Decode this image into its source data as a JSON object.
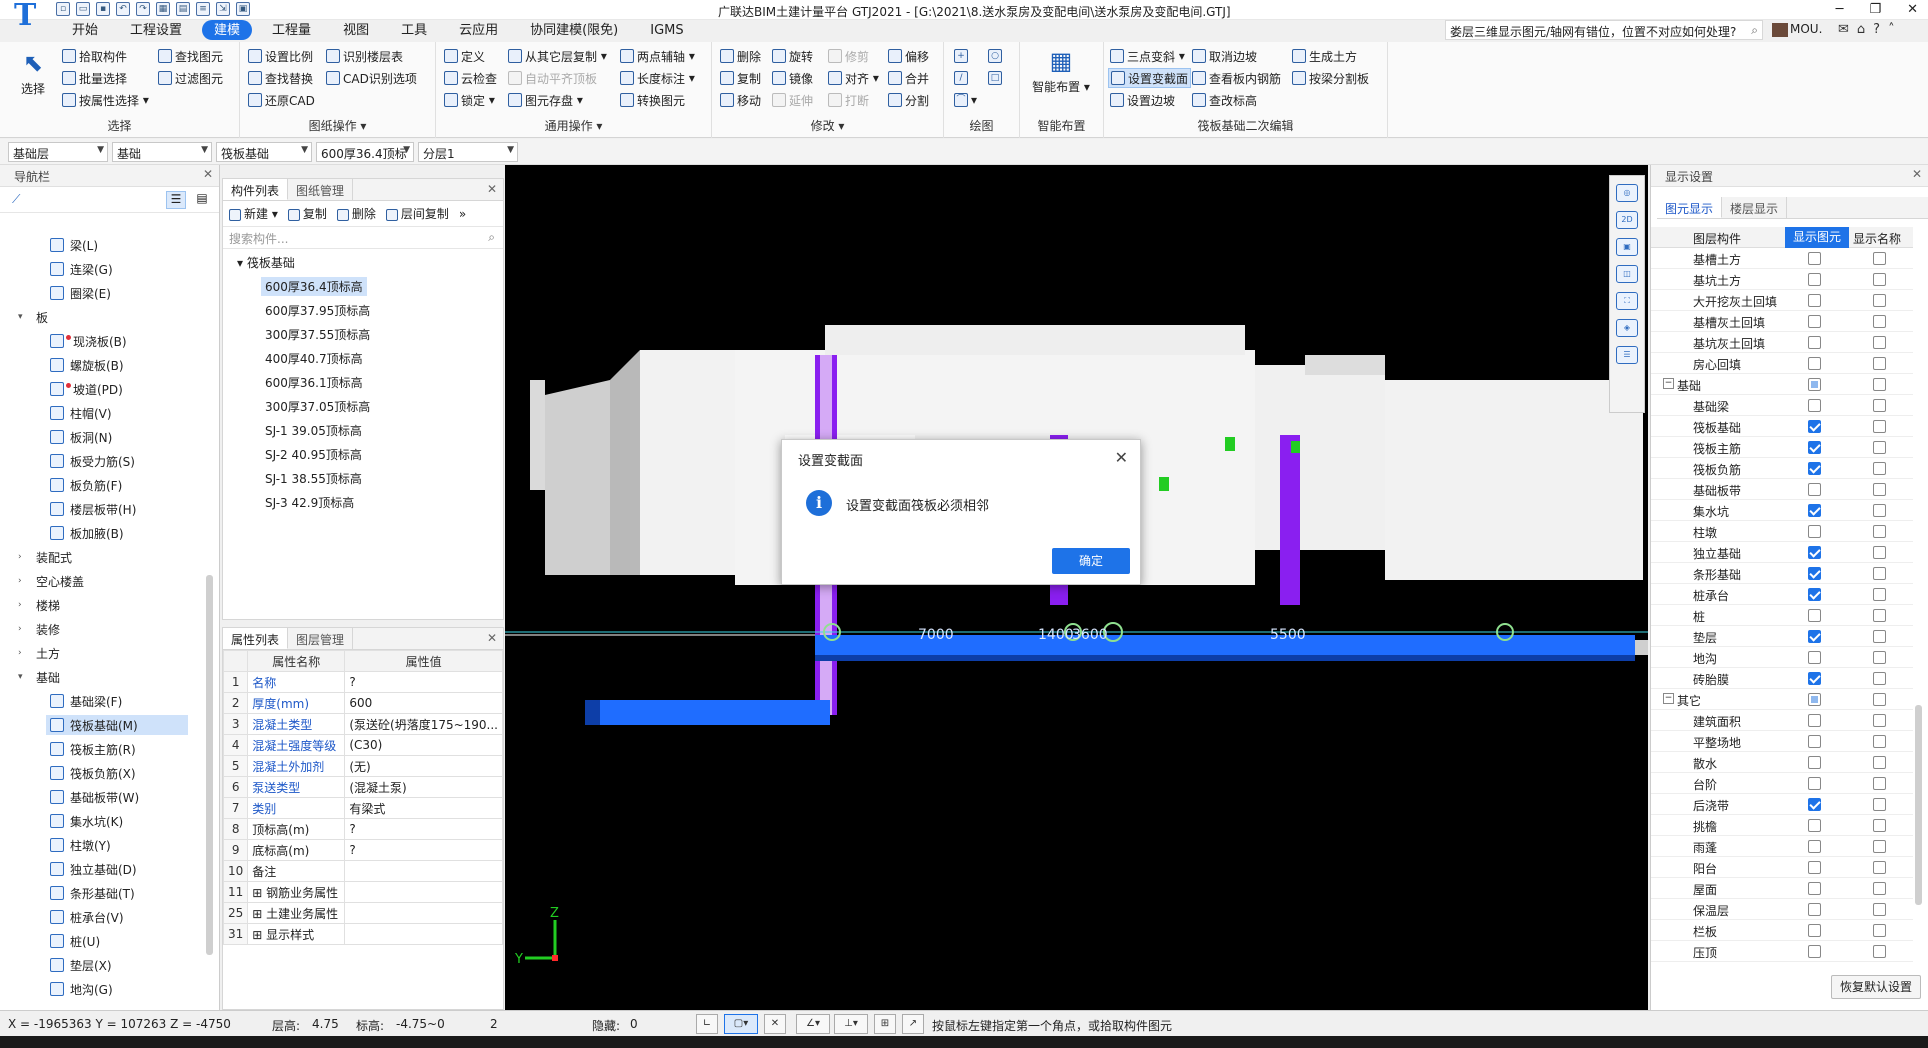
{
  "app": {
    "title": "广联达BIM土建计量平台 GTJ2021 - [G:\\2021\\8.送水泵房及变配电间\\送水泵房及变配电间.GTJ]",
    "logo": "T",
    "help_query": "娄层三维显示图元/轴网有错位，位置不对应如何处理?",
    "user": "MOU."
  },
  "menu": [
    "开始",
    "工程设置",
    "建模",
    "工程量",
    "视图",
    "工具",
    "云应用",
    "协同建模(限免)",
    "IGMS"
  ],
  "menu_active": 2,
  "ribbon": {
    "select": {
      "label": "选择",
      "big": "选择",
      "items": [
        "拾取构件",
        "批量选择",
        "按属性选择",
        "查找图元",
        "过滤图元"
      ]
    },
    "drawing_ops": {
      "label": "图纸操作",
      "items": [
        "设置比例",
        "查找替换",
        "还原CAD",
        "识别楼层表",
        "CAD识别选项"
      ]
    },
    "general_ops": {
      "label": "通用操作",
      "items": [
        "定义",
        "云检查",
        "锁定",
        "从其它层复制",
        "自动平齐顶板",
        "图元存盘",
        "两点辅轴",
        "长度标注",
        "转换图元"
      ]
    },
    "modify": {
      "label": "修改",
      "items": [
        "删除",
        "复制",
        "移动",
        "旋转",
        "镜像",
        "延伸",
        "修剪",
        "对齐",
        "打断",
        "偏移",
        "合并",
        "分割"
      ]
    },
    "draw": {
      "label": "绘图"
    },
    "smart": {
      "label": "智能布置",
      "big": "智能布置"
    },
    "raft_edit": {
      "label": "筏板基础二次编辑",
      "items": [
        "三点变斜",
        "设置变截面",
        "设置边坡",
        "取消边坡",
        "查看板内钢筋",
        "查改标高",
        "生成土方",
        "按梁分割板"
      ]
    }
  },
  "floorbar": [
    "基础层",
    "基础",
    "筏板基础",
    "600厚36.4顶标",
    "分层1"
  ],
  "nav": {
    "title": "导航栏",
    "items": [
      {
        "label": "梁(L)",
        "type": "item"
      },
      {
        "label": "连梁(G)",
        "type": "item"
      },
      {
        "label": "圈梁(E)",
        "type": "item"
      },
      {
        "label": "板",
        "type": "cat",
        "open": true
      },
      {
        "label": "现浇板(B)",
        "type": "item",
        "dot": true
      },
      {
        "label": "螺旋板(B)",
        "type": "item"
      },
      {
        "label": "坡道(PD)",
        "type": "item",
        "dot": true
      },
      {
        "label": "柱帽(V)",
        "type": "item"
      },
      {
        "label": "板洞(N)",
        "type": "item"
      },
      {
        "label": "板受力筋(S)",
        "type": "item"
      },
      {
        "label": "板负筋(F)",
        "type": "item"
      },
      {
        "label": "楼层板带(H)",
        "type": "item"
      },
      {
        "label": "板加腋(B)",
        "type": "item"
      },
      {
        "label": "装配式",
        "type": "cat"
      },
      {
        "label": "空心楼盖",
        "type": "cat"
      },
      {
        "label": "楼梯",
        "type": "cat"
      },
      {
        "label": "装修",
        "type": "cat"
      },
      {
        "label": "土方",
        "type": "cat"
      },
      {
        "label": "基础",
        "type": "cat",
        "open": true
      },
      {
        "label": "基础梁(F)",
        "type": "item"
      },
      {
        "label": "筏板基础(M)",
        "type": "item",
        "selected": true
      },
      {
        "label": "筏板主筋(R)",
        "type": "item"
      },
      {
        "label": "筏板负筋(X)",
        "type": "item"
      },
      {
        "label": "基础板带(W)",
        "type": "item"
      },
      {
        "label": "集水坑(K)",
        "type": "item"
      },
      {
        "label": "柱墩(Y)",
        "type": "item"
      },
      {
        "label": "独立基础(D)",
        "type": "item"
      },
      {
        "label": "条形基础(T)",
        "type": "item"
      },
      {
        "label": "桩承台(V)",
        "type": "item"
      },
      {
        "label": "桩(U)",
        "type": "item"
      },
      {
        "label": "垫层(X)",
        "type": "item"
      },
      {
        "label": "地沟(G)",
        "type": "item"
      }
    ]
  },
  "complist": {
    "tabs": [
      "构件列表",
      "图纸管理"
    ],
    "tools": [
      "新建",
      "复制",
      "删除",
      "层间复制"
    ],
    "search_placeholder": "搜索构件...",
    "root": "筏板基础",
    "items": [
      "600厚36.4顶标高",
      "600厚37.95顶标高",
      "300厚37.55顶标高",
      "400厚40.7顶标高",
      "600厚36.1顶标高",
      "300厚37.05顶标高",
      "SJ-1 39.05顶标高",
      "SJ-2 40.95顶标高",
      "SJ-1 38.55顶标高",
      "SJ-3 42.9顶标高"
    ],
    "selected": 0
  },
  "props": {
    "tabs": [
      "属性列表",
      "图层管理"
    ],
    "headers": [
      "属性名称",
      "属性值"
    ],
    "rows": [
      {
        "n": "1",
        "k": "名称",
        "v": "?",
        "blue": true
      },
      {
        "n": "2",
        "k": "厚度(mm)",
        "v": "600",
        "blue": true
      },
      {
        "n": "3",
        "k": "混凝土类型",
        "v": "(泵送砼(坍落度175~190...",
        "blue": true
      },
      {
        "n": "4",
        "k": "混凝土强度等级",
        "v": "(C30)",
        "blue": true
      },
      {
        "n": "5",
        "k": "混凝土外加剂",
        "v": "(无)",
        "blue": true
      },
      {
        "n": "6",
        "k": "泵送类型",
        "v": "(混凝土泵)",
        "blue": true
      },
      {
        "n": "7",
        "k": "类别",
        "v": "有梁式",
        "blue": true
      },
      {
        "n": "8",
        "k": "顶标高(m)",
        "v": "?",
        "blue": false
      },
      {
        "n": "9",
        "k": "底标高(m)",
        "v": "?",
        "blue": false
      },
      {
        "n": "10",
        "k": "备注",
        "v": "",
        "blue": false
      },
      {
        "n": "11",
        "k": "钢筋业务属性",
        "v": "",
        "blue": false,
        "plus": true
      },
      {
        "n": "25",
        "k": "土建业务属性",
        "v": "",
        "blue": false,
        "plus": true
      },
      {
        "n": "31",
        "k": "显示样式",
        "v": "",
        "blue": false,
        "plus": true
      }
    ]
  },
  "viewport": {
    "dims": [
      "7000",
      "1400",
      "3600",
      "5500"
    ],
    "axis_y": "Y",
    "axis_z": "Z"
  },
  "dialog": {
    "title": "设置变截面",
    "message": "设置变截面筏板必须相邻",
    "ok": "确定"
  },
  "display": {
    "title": "显示设置",
    "tabs": [
      "图元显示",
      "楼层显示"
    ],
    "headers": [
      "图层构件",
      "显示图元",
      "显示名称"
    ],
    "rows": [
      {
        "label": "基槽土方",
        "a": false,
        "b": false
      },
      {
        "label": "基坑土方",
        "a": false,
        "b": false
      },
      {
        "label": "大开挖灰土回填",
        "a": false,
        "b": false
      },
      {
        "label": "基槽灰土回填",
        "a": false,
        "b": false
      },
      {
        "label": "基坑灰土回填",
        "a": false,
        "b": false
      },
      {
        "label": "房心回填",
        "a": false,
        "b": false
      },
      {
        "label": "基础",
        "group": true,
        "a": "partial",
        "b": false
      },
      {
        "label": "基础梁",
        "a": false,
        "b": false
      },
      {
        "label": "筏板基础",
        "a": true,
        "b": false
      },
      {
        "label": "筏板主筋",
        "a": true,
        "b": false
      },
      {
        "label": "筏板负筋",
        "a": true,
        "b": false
      },
      {
        "label": "基础板带",
        "a": false,
        "b": false
      },
      {
        "label": "集水坑",
        "a": true,
        "b": false
      },
      {
        "label": "柱墩",
        "a": false,
        "b": false
      },
      {
        "label": "独立基础",
        "a": true,
        "b": false
      },
      {
        "label": "条形基础",
        "a": true,
        "b": false
      },
      {
        "label": "桩承台",
        "a": true,
        "b": false
      },
      {
        "label": "桩",
        "a": false,
        "b": false
      },
      {
        "label": "垫层",
        "a": true,
        "b": false
      },
      {
        "label": "地沟",
        "a": false,
        "b": false
      },
      {
        "label": "砖胎膜",
        "a": true,
        "b": false
      },
      {
        "label": "其它",
        "group": true,
        "a": "partial",
        "b": false
      },
      {
        "label": "建筑面积",
        "a": false,
        "b": false
      },
      {
        "label": "平整场地",
        "a": false,
        "b": false
      },
      {
        "label": "散水",
        "a": false,
        "b": false
      },
      {
        "label": "台阶",
        "a": false,
        "b": false
      },
      {
        "label": "后浇带",
        "a": true,
        "b": false
      },
      {
        "label": "挑檐",
        "a": false,
        "b": false
      },
      {
        "label": "雨蓬",
        "a": false,
        "b": false
      },
      {
        "label": "阳台",
        "a": false,
        "b": false
      },
      {
        "label": "屋面",
        "a": false,
        "b": false
      },
      {
        "label": "保温层",
        "a": false,
        "b": false
      },
      {
        "label": "栏板",
        "a": false,
        "b": false
      },
      {
        "label": "压顶",
        "a": false,
        "b": false
      }
    ],
    "reset": "恢复默认设置"
  },
  "status": {
    "coords": "X = -1965363 Y = 107263 Z = -4750",
    "floor_h_label": "层高:",
    "floor_h": "4.75",
    "elev_label": "标高:",
    "elev": "-4.75~0",
    "count": "2",
    "hidden_label": "隐藏:",
    "hidden": "0",
    "hint": "按鼠标左键指定第一个角点，或拾取构件图元"
  }
}
